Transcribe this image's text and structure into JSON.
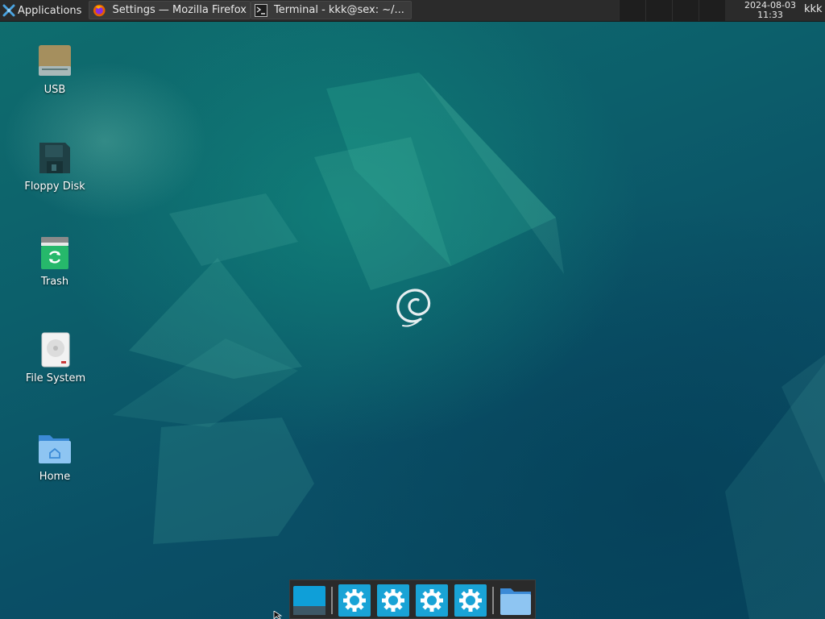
{
  "top_panel": {
    "applications_label": "Applications",
    "tasks": [
      {
        "label": "Settings — Mozilla Firefox",
        "icon": "firefox-icon"
      },
      {
        "label": "Terminal - kkk@sex: ~/...",
        "icon": "terminal-icon"
      }
    ],
    "clock": {
      "date": "2024-08-03",
      "time": "11:33"
    },
    "user": "kkk"
  },
  "desktop": {
    "icons": [
      {
        "label": "USB",
        "icon": "usb-drive-icon"
      },
      {
        "label": "Floppy Disk",
        "icon": "floppy-disk-icon"
      },
      {
        "label": "Trash",
        "icon": "trash-icon"
      },
      {
        "label": "File System",
        "icon": "file-system-icon"
      },
      {
        "label": "Home",
        "icon": "home-folder-icon"
      }
    ]
  },
  "dock": {
    "items": [
      {
        "icon": "show-desktop-icon"
      },
      {
        "icon": "settings-gear-icon"
      },
      {
        "icon": "settings-gear-icon"
      },
      {
        "icon": "settings-gear-icon"
      },
      {
        "icon": "settings-gear-icon"
      },
      {
        "icon": "folder-icon"
      }
    ]
  },
  "colors": {
    "panel_bg": "#2b2b2b",
    "desktop_bg": "#0b4f63",
    "accent": "#19a3d6"
  }
}
